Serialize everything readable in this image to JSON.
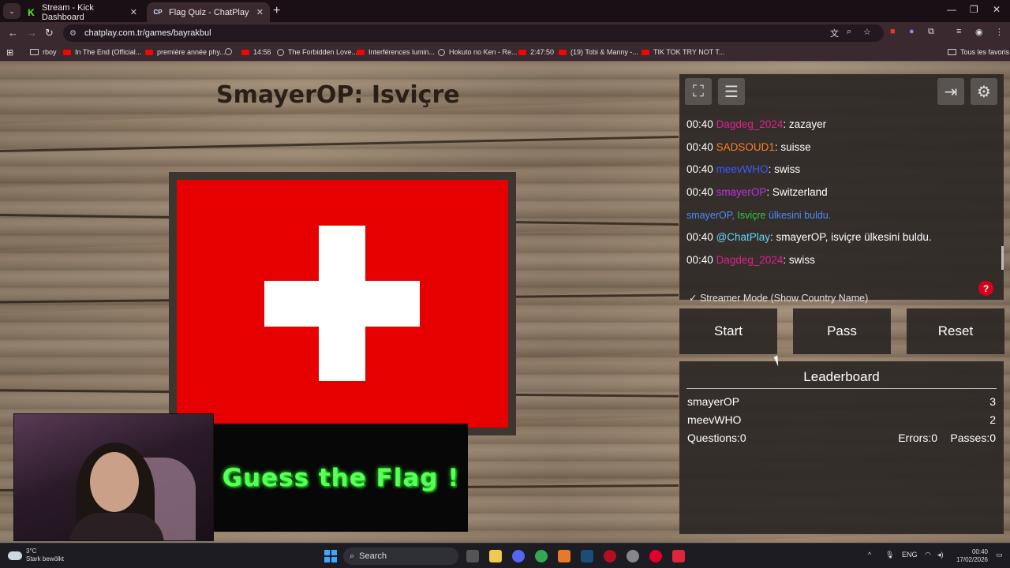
{
  "browser": {
    "tabs": [
      {
        "title": "Stream - Kick Dashboard",
        "favicon": "kick-icon"
      },
      {
        "title": "Flag Quiz - ChatPlay",
        "favicon": "chatplay-icon"
      }
    ],
    "url": "chatplay.com.tr/games/bayrakbul",
    "bookmarks": [
      {
        "label": "rboy",
        "icon": "page-icon"
      },
      {
        "label": "In The End (Official...",
        "icon": "youtube-icon"
      },
      {
        "label": "première année phy...",
        "icon": "youtube-icon"
      },
      {
        "label": "",
        "icon": "globe-icon"
      },
      {
        "label": "14:56",
        "icon": "youtube-icon"
      },
      {
        "label": "The Forbidden Love...",
        "icon": "globe-icon"
      },
      {
        "label": "Interférences lumin...",
        "icon": "youtube-icon"
      },
      {
        "label": "Hokuto no Ken - Re...",
        "icon": "globe-icon"
      },
      {
        "label": "2:47:50",
        "icon": "youtube-icon"
      },
      {
        "label": "(19) Tobi & Manny -...",
        "icon": "youtube-icon"
      },
      {
        "label": "TIK TOK TRY NOT T...",
        "icon": "youtube-icon"
      }
    ],
    "all_bookmarks": "Tous les favoris"
  },
  "game": {
    "title": "SmayerOP: Isviçre",
    "flag": "switzerland",
    "banner_text": "Guess the Flag !",
    "colors": {
      "flag_red": "#e60000",
      "banner_green": "#5aff5a"
    }
  },
  "chat": {
    "messages": [
      {
        "time": "00:40",
        "user": "Dagdeg_2024",
        "user_color": "#e0208f",
        "text": ": zazayer"
      },
      {
        "time": "00:40",
        "user": "SADSOUD1",
        "user_color": "#ff7f27",
        "text": ": suisse"
      },
      {
        "time": "00:40",
        "user": "meevWHO",
        "user_color": "#3b5bff",
        "text": ": swiss"
      },
      {
        "time": "00:40",
        "user": "smayerOP",
        "user_color": "#c030e0",
        "text": ": Switzerland"
      },
      {
        "time": "",
        "system": true,
        "user": "smayerOP,",
        "country": "Isviçre",
        "suffix": "ülkesini buldu."
      },
      {
        "time": "00:40",
        "user": "@ChatPlay",
        "user_color": "#5fd6ff",
        "text": ": smayerOP, isviçre ülkesini buldu."
      },
      {
        "time": "00:40",
        "user": "Dagdeg_2024",
        "user_color": "#e0208f",
        "text": ": swiss"
      }
    ],
    "streamer_mode": "Streamer Mode (Show Country Name)",
    "help": "?"
  },
  "controls": {
    "start": "Start",
    "pass": "Pass",
    "reset": "Reset"
  },
  "leaderboard": {
    "title": "Leaderboard",
    "rows": [
      {
        "name": "smayerOP",
        "score": "3"
      },
      {
        "name": "meevWHO",
        "score": "2"
      }
    ],
    "questions": "Questions:0",
    "errors": "Errors:0",
    "passes": "Passes:0"
  },
  "taskbar": {
    "temp": "3°C",
    "weather": "Stark bewölkt",
    "search": "Search",
    "lang": "ENG",
    "time": "00:40",
    "date": "17/02/2026"
  }
}
